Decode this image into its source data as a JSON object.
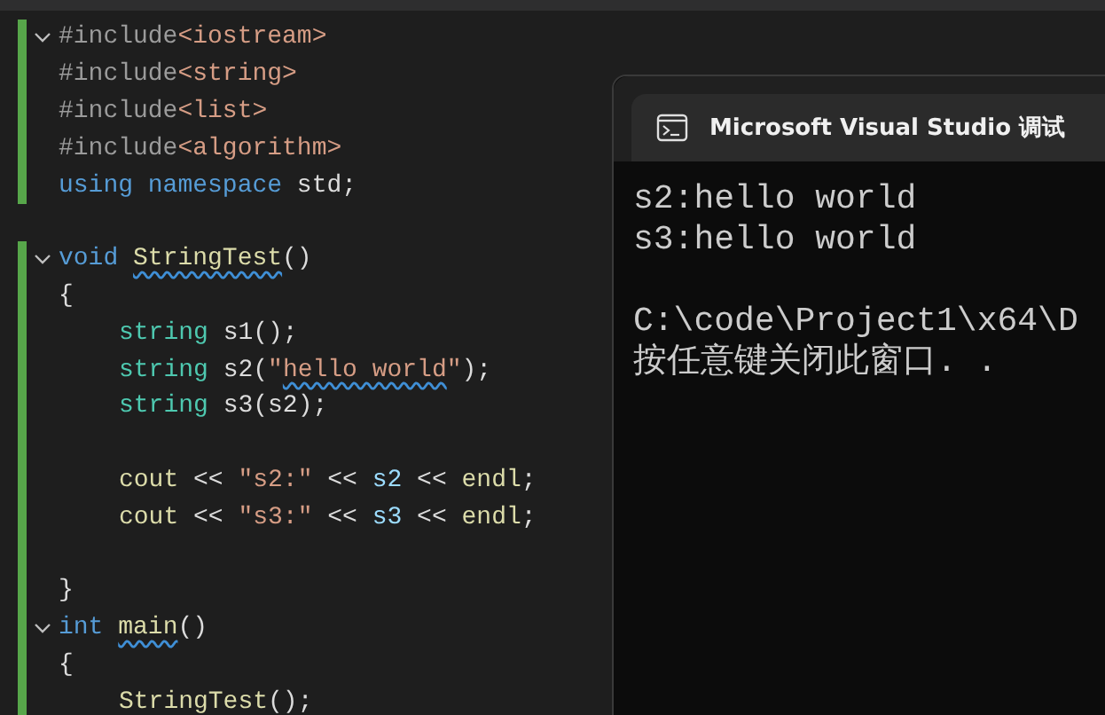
{
  "editor": {
    "blocks": [
      {
        "lines": [
          {
            "kind": "code",
            "collapsible": true,
            "tokens": [
              {
                "kind": "directive",
                "text": "#include"
              },
              {
                "kind": "header",
                "text": "<iostream>"
              }
            ]
          },
          {
            "kind": "code",
            "collapsible": false,
            "tokens": [
              {
                "kind": "directive",
                "text": "#include"
              },
              {
                "kind": "header",
                "text": "<string>"
              }
            ]
          },
          {
            "kind": "code",
            "collapsible": false,
            "tokens": [
              {
                "kind": "directive",
                "text": "#include"
              },
              {
                "kind": "header",
                "text": "<list>"
              }
            ]
          },
          {
            "kind": "code",
            "collapsible": false,
            "tokens": [
              {
                "kind": "directive",
                "text": "#include"
              },
              {
                "kind": "header",
                "text": "<algorithm>"
              }
            ]
          },
          {
            "kind": "code",
            "collapsible": false,
            "tokens": [
              {
                "kind": "keyword",
                "text": "using namespace"
              },
              {
                "kind": "plain",
                "text": " std;"
              }
            ]
          }
        ]
      },
      {
        "lines": [
          {
            "kind": "code",
            "collapsible": true,
            "tokens": [
              {
                "kind": "keyword",
                "text": "void "
              },
              {
                "kind": "function",
                "text": "StringTest",
                "squiggle": true
              },
              {
                "kind": "plain",
                "text": "()"
              }
            ]
          },
          {
            "kind": "code",
            "collapsible": false,
            "tokens": [
              {
                "kind": "plain",
                "text": "{"
              }
            ],
            "children": [
              {
                "kind": "code",
                "collapsible": false,
                "tokens": [
                  {
                    "kind": "type",
                    "text": "string "
                  },
                  {
                    "kind": "plain",
                    "text": "s1();"
                  }
                ]
              },
              {
                "kind": "code",
                "collapsible": false,
                "tokens": [
                  {
                    "kind": "type",
                    "text": "string "
                  },
                  {
                    "kind": "plain",
                    "text": "s2("
                  },
                  {
                    "kind": "string",
                    "text": "\""
                  },
                  {
                    "kind": "string",
                    "text": "hello",
                    "squiggle": true
                  },
                  {
                    "kind": "string",
                    "text": " world",
                    "squiggle": true
                  },
                  {
                    "kind": "string",
                    "text": "\""
                  },
                  {
                    "kind": "plain",
                    "text": ");"
                  }
                ]
              },
              {
                "kind": "code",
                "collapsible": false,
                "tokens": [
                  {
                    "kind": "type",
                    "text": "string "
                  },
                  {
                    "kind": "plain",
                    "text": "s3(s2);"
                  }
                ]
              },
              {
                "kind": "blank"
              },
              {
                "kind": "code",
                "collapsible": false,
                "tokens": [
                  {
                    "kind": "function",
                    "text": "cout"
                  },
                  {
                    "kind": "plain",
                    "text": " << "
                  },
                  {
                    "kind": "string",
                    "text": "\"s2:\""
                  },
                  {
                    "kind": "plain",
                    "text": " << "
                  },
                  {
                    "kind": "variable",
                    "text": "s2"
                  },
                  {
                    "kind": "plain",
                    "text": " << "
                  },
                  {
                    "kind": "function",
                    "text": "endl"
                  },
                  {
                    "kind": "plain",
                    "text": ";"
                  }
                ]
              },
              {
                "kind": "code",
                "collapsible": false,
                "tokens": [
                  {
                    "kind": "function",
                    "text": "cout"
                  },
                  {
                    "kind": "plain",
                    "text": " << "
                  },
                  {
                    "kind": "string",
                    "text": "\"s3:\""
                  },
                  {
                    "kind": "plain",
                    "text": " << "
                  },
                  {
                    "kind": "variable",
                    "text": "s3"
                  },
                  {
                    "kind": "plain",
                    "text": " << "
                  },
                  {
                    "kind": "function",
                    "text": "endl"
                  },
                  {
                    "kind": "plain",
                    "text": ";"
                  }
                ]
              },
              {
                "kind": "blank"
              }
            ]
          },
          {
            "kind": "code",
            "collapsible": false,
            "tokens": [
              {
                "kind": "plain",
                "text": "}"
              }
            ]
          },
          {
            "kind": "code",
            "collapsible": true,
            "tokens": [
              {
                "kind": "keyword",
                "text": "int "
              },
              {
                "kind": "function",
                "text": "main",
                "squiggle": true
              },
              {
                "kind": "plain",
                "text": "()"
              }
            ]
          },
          {
            "kind": "code",
            "collapsible": false,
            "tokens": [
              {
                "kind": "plain",
                "text": "{"
              }
            ],
            "children": [
              {
                "kind": "code",
                "collapsible": false,
                "tokens": [
                  {
                    "kind": "function",
                    "text": "StringTest"
                  },
                  {
                    "kind": "plain",
                    "text": "();"
                  }
                ]
              }
            ]
          }
        ]
      }
    ]
  },
  "console": {
    "title": "Microsoft Visual Studio 调试",
    "output": [
      "s2:hello world",
      "s3:hello world"
    ],
    "footer": [
      "C:\\code\\Project1\\x64\\D",
      "按任意键关闭此窗口. ."
    ]
  }
}
